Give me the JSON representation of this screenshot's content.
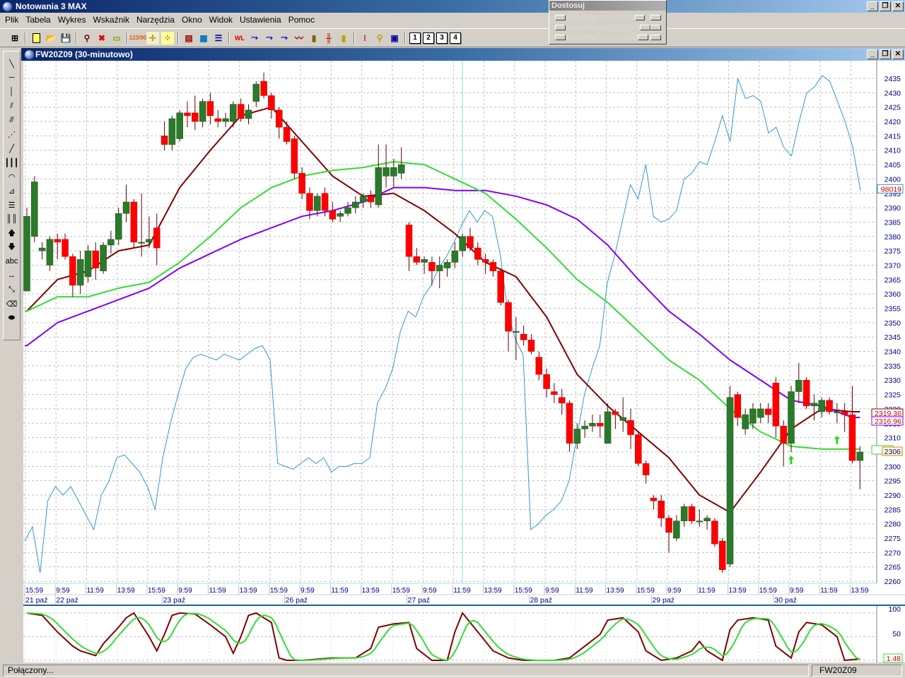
{
  "app": {
    "title": "Notowania 3 MAX"
  },
  "menu": [
    "Plik",
    "Tabela",
    "Wykres",
    "Wskaźnik",
    "Narzędzia",
    "Okno",
    "Widok",
    "Ustawienia",
    "Pomoc"
  ],
  "toolbar": {
    "icons": [
      "grid-icon",
      "new-file-icon",
      "open-folder-icon",
      "save-icon",
      "zoom-icon",
      "delete-icon",
      "ruler-icon",
      "numbers-icon",
      "crosshair-icon",
      "crosshair-alt-icon",
      "table-icon",
      "colors-icon",
      "list-icon",
      "wl-icon",
      "arrow-step-icon",
      "arrow-step-2-icon",
      "arrow-step-3-icon",
      "line-chart-icon",
      "bar-chart-icon",
      "ohlc-icon",
      "candle-icon",
      "traffic-light-icon",
      "zoom-add-icon",
      "window-add-icon"
    ],
    "layout_buttons": [
      "1",
      "2",
      "3",
      "4"
    ],
    "numbers_label": "123/90",
    "wl_label": "WL"
  },
  "adjust_panel": {
    "title": "Dostosuj"
  },
  "chart_window": {
    "title": "FW20Z09 (30-minutowo)"
  },
  "left_tools": {
    "abc_label": "abc"
  },
  "status": {
    "left": "Połączony...",
    "right": "FW20Z09"
  },
  "chart_data": {
    "type": "candlestick",
    "instrument": "FW20Z09",
    "interval": "30-minutowo",
    "ylim": [
      2260,
      2435
    ],
    "price_ticks": [
      2435,
      2430,
      2425,
      2420,
      2415,
      2410,
      2405,
      2400,
      2395,
      2390,
      2385,
      2380,
      2375,
      2370,
      2365,
      2360,
      2355,
      2350,
      2345,
      2340,
      2335,
      2330,
      2325,
      2320,
      2315,
      2310,
      2305,
      2300,
      2295,
      2290,
      2285,
      2280,
      2275,
      2270,
      2265,
      2260
    ],
    "time_labels": [
      "15:59",
      "9:59",
      "11:59",
      "13:59",
      "15:59",
      "9:59",
      "11:59",
      "13:59",
      "15:59",
      "9:59",
      "11:59",
      "13:59",
      "15:59",
      "9:59",
      "11:59",
      "13:59",
      "15:59",
      "9:59",
      "11:59",
      "13:59",
      "15:59",
      "9:59",
      "11:59",
      "13:59",
      "15:59",
      "9:59",
      "11:59",
      "13:59"
    ],
    "date_labels": [
      {
        "label": "21 paź",
        "candle": 0
      },
      {
        "label": "22 paź",
        "candle": 4
      },
      {
        "label": "23 paź",
        "candle": 18
      },
      {
        "label": "26 paź",
        "candle": 34
      },
      {
        "label": "27 paź",
        "candle": 50
      },
      {
        "label": "28 paź",
        "candle": 66
      },
      {
        "label": "29 paź",
        "candle": 82
      },
      {
        "label": "30 paź",
        "candle": 98
      }
    ],
    "ohlc": [
      [
        2361,
        2390,
        2361,
        2387
      ],
      [
        2380,
        2401,
        2378,
        2399
      ],
      [
        2375,
        2378,
        2372,
        2376
      ],
      [
        2370,
        2380,
        2368,
        2379
      ],
      [
        2379,
        2381,
        2372,
        2378
      ],
      [
        2379,
        2381,
        2372,
        2373
      ],
      [
        2373,
        2374,
        2359,
        2363
      ],
      [
        2363,
        2375,
        2360,
        2372
      ],
      [
        2366,
        2377,
        2364,
        2375
      ],
      [
        2375,
        2378,
        2365,
        2369
      ],
      [
        2368,
        2378,
        2367,
        2377
      ],
      [
        2377,
        2382,
        2374,
        2379
      ],
      [
        2379,
        2390,
        2377,
        2388
      ],
      [
        2388,
        2398,
        2385,
        2392
      ],
      [
        2392,
        2393,
        2376,
        2378
      ],
      [
        2378,
        2395,
        2373,
        2378
      ],
      [
        2378,
        2387,
        2376,
        2379
      ],
      [
        2383,
        2388,
        2370,
        2376
      ],
      [
        2415,
        2420,
        2410,
        2412
      ],
      [
        2412,
        2422,
        2410,
        2421
      ],
      [
        2414,
        2424,
        2413,
        2423
      ],
      [
        2423,
        2427,
        2418,
        2422
      ],
      [
        2423,
        2429,
        2417,
        2420
      ],
      [
        2420,
        2428,
        2418,
        2427
      ],
      [
        2427,
        2430,
        2419,
        2422
      ],
      [
        2421,
        2424,
        2418,
        2420
      ],
      [
        2420,
        2423,
        2418,
        2421
      ],
      [
        2420,
        2427,
        2418,
        2426
      ],
      [
        2426,
        2428,
        2420,
        2421
      ],
      [
        2421,
        2426,
        2419,
        2424
      ],
      [
        2427,
        2434,
        2425,
        2433
      ],
      [
        2434,
        2437,
        2428,
        2429
      ],
      [
        2429,
        2430,
        2421,
        2424
      ],
      [
        2424,
        2425,
        2414,
        2418
      ],
      [
        2418,
        2420,
        2412,
        2413
      ],
      [
        2414,
        2415,
        2400,
        2402
      ],
      [
        2402,
        2404,
        2393,
        2395
      ],
      [
        2395,
        2397,
        2386,
        2389
      ],
      [
        2389,
        2395,
        2387,
        2394
      ],
      [
        2395,
        2397,
        2387,
        2389
      ],
      [
        2389,
        2392,
        2385,
        2386
      ],
      [
        2387,
        2389,
        2385,
        2388
      ],
      [
        2388,
        2392,
        2387,
        2390
      ],
      [
        2390,
        2394,
        2388,
        2392
      ],
      [
        2392,
        2395,
        2390,
        2394
      ],
      [
        2394,
        2396,
        2390,
        2392
      ],
      [
        2391,
        2412,
        2390,
        2404
      ],
      [
        2401,
        2412,
        2397,
        2404
      ],
      [
        2401,
        2407,
        2397,
        2404
      ],
      [
        2402,
        2411,
        2400,
        2405
      ],
      [
        2384,
        2385,
        2368,
        2373
      ],
      [
        2373,
        2376,
        2370,
        2371
      ],
      [
        2371,
        2373,
        2367,
        2372
      ],
      [
        2371,
        2373,
        2363,
        2368
      ],
      [
        2368,
        2373,
        2362,
        2370
      ],
      [
        2369,
        2372,
        2366,
        2371
      ],
      [
        2371,
        2378,
        2369,
        2375
      ],
      [
        2375,
        2381,
        2373,
        2380
      ],
      [
        2380,
        2383,
        2375,
        2376
      ],
      [
        2376,
        2378,
        2370,
        2372
      ],
      [
        2372,
        2374,
        2367,
        2371
      ],
      [
        2371,
        2372,
        2366,
        2368
      ],
      [
        2368,
        2369,
        2356,
        2357
      ],
      [
        2357,
        2358,
        2340,
        2347
      ],
      [
        2347,
        2352,
        2337,
        2347
      ],
      [
        2346,
        2349,
        2342,
        2344
      ],
      [
        2344,
        2346,
        2339,
        2340
      ],
      [
        2338,
        2340,
        2330,
        2332
      ],
      [
        2332,
        2334,
        2324,
        2327
      ],
      [
        2326,
        2329,
        2322,
        2325
      ],
      [
        2324,
        2327,
        2318,
        2322
      ],
      [
        2322,
        2323,
        2305,
        2308
      ],
      [
        2308,
        2315,
        2306,
        2313
      ],
      [
        2313,
        2316,
        2310,
        2314
      ],
      [
        2314,
        2318,
        2312,
        2315
      ],
      [
        2315,
        2318,
        2310,
        2314
      ],
      [
        2308,
        2322,
        2308,
        2319
      ],
      [
        2319,
        2320,
        2313,
        2318
      ],
      [
        2316,
        2324,
        2312,
        2317
      ],
      [
        2316,
        2320,
        2306,
        2311
      ],
      [
        2311,
        2312,
        2300,
        2301
      ],
      [
        2301,
        2302,
        2294,
        2297
      ],
      [
        2289,
        2290,
        2285,
        2288
      ],
      [
        2288,
        2290,
        2279,
        2282
      ],
      [
        2282,
        2283,
        2270,
        2277
      ],
      [
        2275,
        2283,
        2274,
        2281
      ],
      [
        2281,
        2287,
        2279,
        2286
      ],
      [
        2286,
        2287,
        2280,
        2281
      ],
      [
        2281,
        2285,
        2279,
        2281
      ],
      [
        2281,
        2283,
        2278,
        2282
      ],
      [
        2281,
        2282,
        2272,
        2273
      ],
      [
        2274,
        2275,
        2263,
        2264
      ],
      [
        2266,
        2328,
        2265,
        2324
      ],
      [
        2325,
        2326,
        2314,
        2317
      ],
      [
        2313,
        2320,
        2311,
        2318
      ],
      [
        2315,
        2322,
        2313,
        2320
      ],
      [
        2317,
        2322,
        2315,
        2320
      ],
      [
        2320,
        2322,
        2315,
        2318
      ],
      [
        2329,
        2331,
        2310,
        2314
      ],
      [
        2314,
        2316,
        2300,
        2308
      ],
      [
        2308,
        2328,
        2305,
        2326
      ],
      [
        2326,
        2336,
        2322,
        2330
      ],
      [
        2330,
        2331,
        2320,
        2321
      ],
      [
        2321,
        2325,
        2316,
        2322
      ],
      [
        2319,
        2324,
        2317,
        2323
      ],
      [
        2323,
        2324,
        2318,
        2319
      ],
      [
        2319,
        2322,
        2315,
        2319
      ],
      [
        2319,
        2322,
        2312,
        2318
      ],
      [
        2318,
        2328,
        2301,
        2302
      ],
      [
        2302,
        2307,
        2292,
        2305
      ]
    ],
    "ma_lines": [
      {
        "name": "MA short",
        "color": "#800000",
        "value_label": "2319.36",
        "values_every_4": [
          2354,
          2365,
          2368,
          2375,
          2377,
          2397,
          2410,
          2422,
          2425,
          2413,
          2401,
          2394,
          2395,
          2389,
          2381,
          2371,
          2366,
          2352,
          2332,
          2321,
          2312,
          2303,
          2290,
          2284,
          2298,
          2313,
          2320,
          2319
        ]
      },
      {
        "name": "MA long",
        "color": "#8000ff",
        "value_label": "2316.96",
        "values_every_4": [
          2342,
          2350,
          2354,
          2358,
          2362,
          2369,
          2374,
          2379,
          2383,
          2387,
          2389,
          2392,
          2397,
          2397,
          2396,
          2396,
          2394,
          2391,
          2386,
          2377,
          2365,
          2354,
          2346,
          2337,
          2330,
          2323,
          2321,
          2317
        ]
      },
      {
        "name": "MA mid",
        "color": "#33dd33",
        "value_label": "23",
        "values_every_4": [
          2354,
          2359,
          2359,
          2362,
          2364,
          2371,
          2380,
          2390,
          2397,
          2401,
          2403,
          2404,
          2406,
          2405,
          2400,
          2395,
          2386,
          2376,
          2365,
          2357,
          2347,
          2337,
          2330,
          2320,
          2312,
          2307,
          2306,
          2306
        ]
      }
    ],
    "overlay": {
      "name": "overlay",
      "color": "#3399cc",
      "value_label": "98019",
      "values": [
        2274,
        2279,
        2263,
        2288,
        2293,
        2290,
        2293,
        2288,
        2283,
        2278,
        2290,
        2295,
        2303,
        2304,
        2301,
        2298,
        2293,
        2285,
        2303,
        2315,
        2325,
        2334,
        2338,
        2339,
        2338,
        2337,
        2339,
        2338,
        2337,
        2339,
        2341,
        2342,
        2337,
        2301,
        2300,
        2299,
        2301,
        2303,
        2301,
        2303,
        2298,
        2300,
        2300,
        2301,
        2301,
        2303,
        2322,
        2327,
        2334,
        2347,
        2354,
        2352,
        2359,
        2363,
        2369,
        2373,
        2378,
        2384,
        2389,
        2385,
        2389,
        2387,
        2374,
        2354,
        2344,
        2339,
        2278,
        2280,
        2283,
        2285,
        2288,
        2295,
        2310,
        2325,
        2334,
        2342,
        2364,
        2374,
        2386,
        2398,
        2393,
        2405,
        2387,
        2385,
        2386,
        2389,
        2400,
        2402,
        2406,
        2405,
        2413,
        2422,
        2413,
        2435,
        2428,
        2429,
        2427,
        2416,
        2418,
        2411,
        2408,
        2420,
        2430,
        2432,
        2436,
        2434,
        2427,
        2420,
        2411,
        2396
      ]
    },
    "price_boxes": {
      "last": "2306"
    },
    "signals": [
      {
        "type": "buy-arrow",
        "candle": 100,
        "price": 2302
      },
      {
        "type": "buy-arrow",
        "candle": 106,
        "price": 2309
      }
    ],
    "oscillator": {
      "ylim": [
        0,
        100
      ],
      "ticks": [
        "100",
        "50"
      ],
      "value_label": "1.48",
      "k_points": [
        [
          0,
          100
        ],
        [
          2,
          95
        ],
        [
          4,
          60
        ],
        [
          6,
          30
        ],
        [
          7,
          20
        ],
        [
          8,
          15
        ],
        [
          9,
          10
        ],
        [
          10,
          35
        ],
        [
          12,
          70
        ],
        [
          13,
          90
        ],
        [
          14,
          100
        ],
        [
          15,
          75
        ],
        [
          16,
          50
        ],
        [
          17,
          20
        ],
        [
          18,
          55
        ],
        [
          19,
          95
        ],
        [
          20,
          100
        ],
        [
          22,
          98
        ],
        [
          24,
          75
        ],
        [
          26,
          50
        ],
        [
          27,
          15
        ],
        [
          28,
          50
        ],
        [
          29,
          95
        ],
        [
          30,
          100
        ],
        [
          32,
          80
        ],
        [
          33,
          5
        ],
        [
          34,
          0
        ],
        [
          36,
          0
        ],
        [
          40,
          5
        ],
        [
          43,
          5
        ],
        [
          45,
          25
        ],
        [
          46,
          70
        ],
        [
          48,
          77
        ],
        [
          50,
          80
        ],
        [
          51,
          25
        ],
        [
          53,
          0
        ],
        [
          55,
          0
        ],
        [
          56,
          60
        ],
        [
          57,
          100
        ],
        [
          59,
          60
        ],
        [
          61,
          20
        ],
        [
          63,
          5
        ],
        [
          65,
          0
        ],
        [
          69,
          0
        ],
        [
          71,
          5
        ],
        [
          73,
          30
        ],
        [
          75,
          55
        ],
        [
          76,
          85
        ],
        [
          78,
          90
        ],
        [
          80,
          60
        ],
        [
          81,
          20
        ],
        [
          83,
          0
        ],
        [
          85,
          5
        ],
        [
          87,
          20
        ],
        [
          88,
          40
        ],
        [
          89,
          20
        ],
        [
          91,
          0
        ],
        [
          92,
          65
        ],
        [
          93,
          85
        ],
        [
          95,
          90
        ],
        [
          97,
          85
        ],
        [
          98,
          30
        ],
        [
          100,
          5
        ],
        [
          101,
          60
        ],
        [
          102,
          80
        ],
        [
          104,
          75
        ],
        [
          106,
          50
        ],
        [
          107,
          0
        ],
        [
          109,
          3
        ]
      ]
    },
    "colors": {
      "up": "#2a7a2a",
      "down": "#ff0000",
      "grid": "#c0c0c0",
      "axis_text": "#000080",
      "cursor": "#80e0e0"
    }
  }
}
